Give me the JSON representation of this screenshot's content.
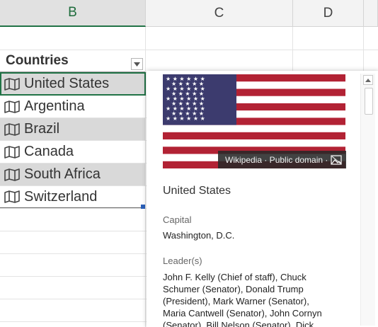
{
  "columns": [
    {
      "label": "B",
      "selected": true
    },
    {
      "label": "C",
      "selected": false
    },
    {
      "label": "D",
      "selected": false
    }
  ],
  "table": {
    "header": "Countries",
    "rows": [
      {
        "label": "United States",
        "icon": "map-icon",
        "shaded": true
      },
      {
        "label": "Argentina",
        "icon": "map-icon",
        "shaded": false
      },
      {
        "label": "Brazil",
        "icon": "map-icon",
        "shaded": true
      },
      {
        "label": "Canada",
        "icon": "map-icon",
        "shaded": false
      },
      {
        "label": "South Africa",
        "icon": "map-icon",
        "shaded": true
      },
      {
        "label": "Switzerland",
        "icon": "map-icon",
        "shaded": false
      }
    ]
  },
  "card": {
    "attribution": "Wikipedia · Public domain ·",
    "title": "United States",
    "fields": [
      {
        "label": "Capital",
        "value": "Washington, D.C."
      },
      {
        "label": "Leader(s)",
        "value": "John F. Kelly (Chief of staff), Chuck Schumer (Senator), Donald Trump (President), Mark Warner (Senator), Maria Cantwell (Senator), John Cornyn (Senator), Bill Nelson (Senator), Dick"
      }
    ]
  },
  "colors": {
    "accent": "#217346",
    "flag_red": "#b22234",
    "flag_blue": "#3c3b6e",
    "shaded_row": "#d9d9d9"
  }
}
